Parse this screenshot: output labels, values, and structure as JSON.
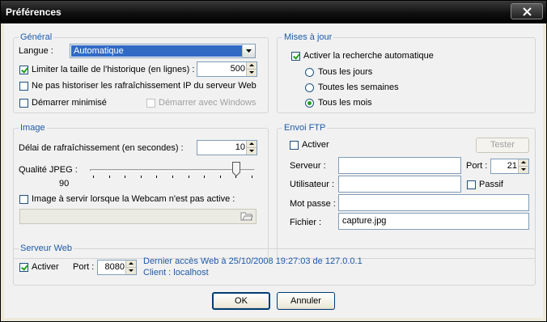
{
  "window": {
    "title": "Préférences"
  },
  "general": {
    "group_title": "Général",
    "language_label": "Langue :",
    "language_value": "Automatique",
    "limit_history_label": "Limiter la taille de l'historique (en lignes) :",
    "limit_history_checked": true,
    "history_value": "500",
    "no_ip_history_label": "Ne pas historiser les rafraîchissement IP du serveur Web",
    "no_ip_history_checked": false,
    "start_minimized_label": "Démarrer minimisé",
    "start_minimized_checked": false,
    "start_with_windows_label": "Démarrer avec Windows",
    "start_with_windows_checked": false
  },
  "updates": {
    "group_title": "Mises à jour",
    "auto_check_label": "Activer la recherche automatique",
    "auto_check_checked": true,
    "options": [
      {
        "label": "Tous les jours",
        "checked": false
      },
      {
        "label": "Toutes les semaines",
        "checked": false
      },
      {
        "label": "Tous les mois",
        "checked": true
      }
    ]
  },
  "image": {
    "group_title": "Image",
    "refresh_label": "Délai de rafraîchissement (en secondes) :",
    "refresh_value": "10",
    "jpeg_label": "Qualité JPEG :",
    "jpeg_value": "90",
    "jpeg_level_percent": 90,
    "inactive_image_label": "Image à servir lorsque la Webcam n'est pas active :",
    "inactive_image_checked": false,
    "inactive_image_path": ""
  },
  "ftp": {
    "group_title": "Envoi FTP",
    "enable_label": "Activer",
    "enable_checked": false,
    "test_button": "Tester",
    "server_label": "Serveur :",
    "server_value": "",
    "port_label": "Port :",
    "port_value": "21",
    "user_label": "Utilisateur :",
    "user_value": "",
    "passive_label": "Passif",
    "passive_checked": false,
    "password_label": "Mot passe :",
    "password_value": "",
    "file_label": "Fichier :",
    "file_value": "capture.jpg"
  },
  "web_server": {
    "group_title": "Serveur Web",
    "enable_label": "Activer",
    "enable_checked": true,
    "port_label": "Port :",
    "port_value": "8080",
    "last_access": "Dernier accès Web à 25/10/2008 19:27:03 de 127.0.0.1",
    "client": "Client : localhost"
  },
  "buttons": {
    "ok": "OK",
    "cancel": "Annuler"
  },
  "icons": {
    "close": "close-icon",
    "folder": "folder-open-icon",
    "dropdown": "chevron-down-icon"
  },
  "colors": {
    "group_title": "#1e5aa8",
    "check": "#21a121",
    "selection": "#316ac5"
  }
}
